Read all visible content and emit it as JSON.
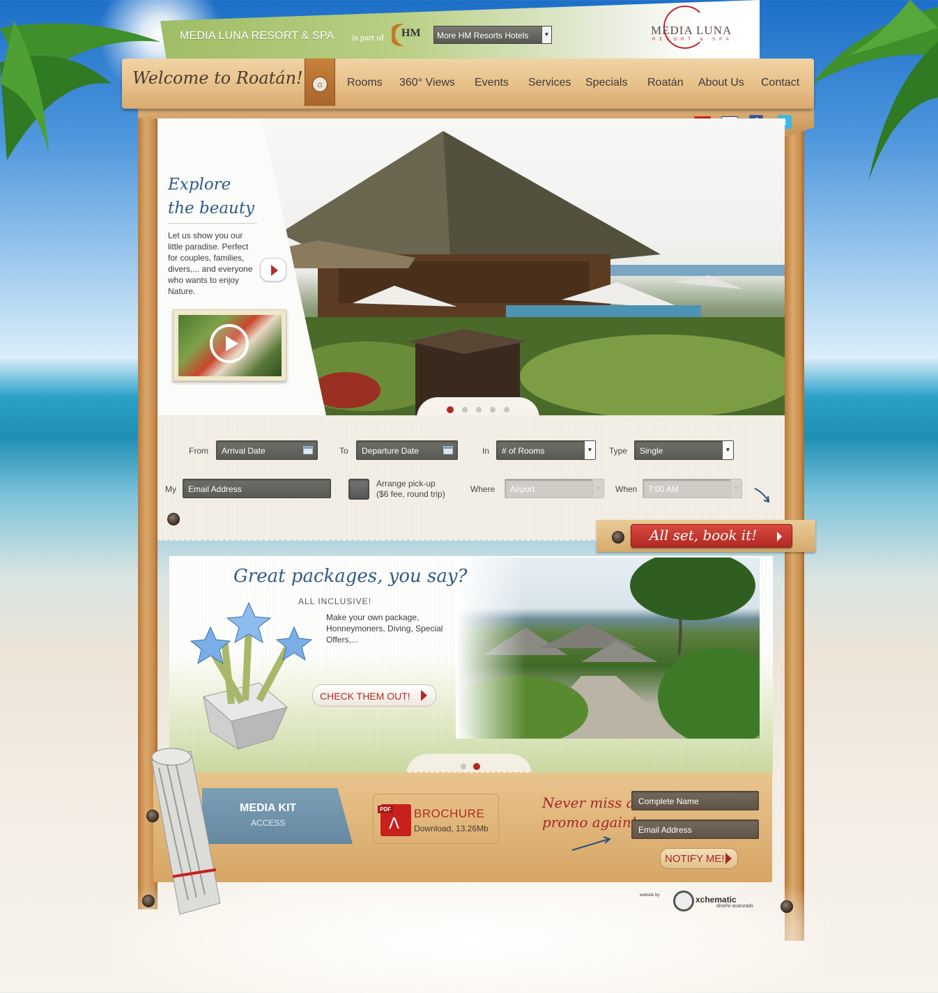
{
  "header": {
    "resort_name": "MEDIA LUNA RESORT & SPA",
    "is_part_of": "is part of",
    "hm_logo": "HM",
    "hotels_select": "More HM Resorts Hotels",
    "logo_name": "MEDIA LUNA",
    "logo_sub": "RESORT & SPA"
  },
  "nav": {
    "welcome": "Welcome to Roatán!",
    "home_icon": "home-icon",
    "items": [
      "Rooms",
      "360° Views",
      "Events",
      "Services",
      "Specials",
      "Roatán",
      "About Us",
      "Contact"
    ]
  },
  "social": {
    "flags": [
      {
        "name": "spanish-flag-icon",
        "color": "#c8201d"
      },
      {
        "name": "english-flag-icon",
        "color": "#1f3b8a"
      },
      {
        "name": "facebook-icon",
        "color": "#3b5998"
      },
      {
        "name": "twitter-icon",
        "color": "#3fb6e6"
      }
    ]
  },
  "hero": {
    "title_line1": "Explore",
    "title_line2": "the beauty",
    "text": "Let us show you our little paradise. Perfect for couples, families, divers,... and everyone who wants to enjoy Nature.",
    "slides_total": 5,
    "slide_active": 1
  },
  "booking": {
    "from_label": "From",
    "arrival_placeholder": "Arrival Date",
    "to_label": "To",
    "departure_placeholder": "Departure Date",
    "in_label": "In",
    "rooms_value": "# of Rooms",
    "type_label": "Type",
    "type_value": "Single",
    "my_label": "My",
    "email_placeholder": "Email Address",
    "pickup_label_1": "Arrange pick-up",
    "pickup_label_2": "($6 fee, round trip)",
    "where_label": "Where",
    "where_value": "Airport",
    "when_label": "When",
    "when_value": "7:00 AM",
    "book_button": "All set, book it!"
  },
  "packages": {
    "title": "Great packages, you say?",
    "subtitle": "ALL INCLUSIVE!",
    "text": "Make your own package, Honneymoners, Diving, Special Offers,...",
    "button": "CHECK THEM OUT!",
    "slides_total": 2,
    "slide_active": 2
  },
  "footer": {
    "media_kit_title": "MEDIA KIT",
    "media_kit_sub": "ACCESS",
    "pdf_tag": "PDF",
    "brochure_title": "BROCHURE",
    "brochure_sub": "Download, 13.26Mb",
    "never_miss_1": "Never miss a",
    "never_miss_2": "promo again!",
    "name_placeholder": "Complete Name",
    "email_placeholder": "Email Address",
    "notify_button": "NOTIFY ME!",
    "credit_by": "website by",
    "credit_name": "xchematic",
    "credit_sub": "diseño avanzado"
  }
}
